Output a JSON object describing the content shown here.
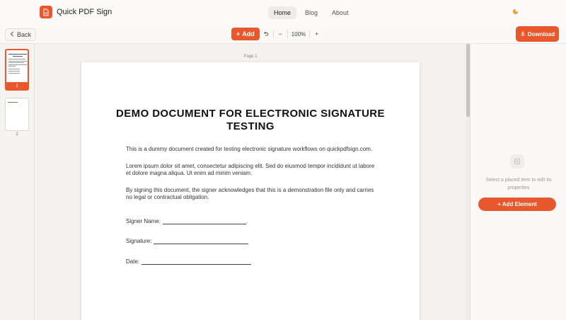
{
  "app": {
    "title": "Quick PDF Sign",
    "logo_icon": "document-icon",
    "accent_color": "#e8582c"
  },
  "nav": {
    "links": [
      {
        "label": "Home",
        "active": true
      },
      {
        "label": "Blog",
        "active": false
      },
      {
        "label": "About",
        "active": false
      }
    ],
    "theme_icon": "moon-icon"
  },
  "toolbar": {
    "back_label": "Back",
    "add_label": "Add",
    "zoom_value": "100%",
    "download_label": "Download"
  },
  "sidebar": {
    "pages": [
      {
        "number": "1",
        "active": true
      },
      {
        "number": "2",
        "active": false
      }
    ]
  },
  "document": {
    "page_label": "Page 1",
    "title": "DEMO DOCUMENT FOR ELECTRONIC SIGNATURE TESTING",
    "paragraphs": [
      "This is a dummy document created for testing electronic signature workflows on quickpdfsign.com.",
      "Lorem ipsum dolor sit amet, consectetur adipiscing elit. Sed do eiusmod tempor incididunt ut labore et dolore magna aliqua. Ut enim ad minim veniam.",
      "By signing this document, the signer acknowledges that this is a demonstration file only and carries no legal or contractual obligation."
    ],
    "fields": [
      {
        "label": "Signer Name:",
        "trail": "."
      },
      {
        "label": "Signature:",
        "trail": ""
      },
      {
        "label": "Date:",
        "trail": ""
      }
    ]
  },
  "properties": {
    "empty_message": "Select a placed item to edit its properties",
    "add_element_label": "+ Add Element"
  }
}
